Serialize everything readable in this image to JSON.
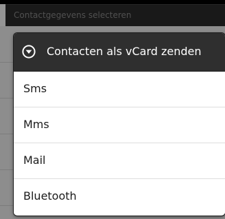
{
  "screen": {
    "title": "Contactgegevens selecteren"
  },
  "dialog": {
    "title": "Contacten als vCard zenden",
    "icon": "chevron-down-circle-icon",
    "items": [
      {
        "label": "Sms"
      },
      {
        "label": "Mms"
      },
      {
        "label": "Mail"
      },
      {
        "label": "Bluetooth"
      }
    ]
  },
  "colors": {
    "header_bg": "#2f2f2f",
    "title_bar_bg": "#2b2b2b",
    "dim_overlay": "rgba(0,0,0,0.42)",
    "item_text": "#1a1a1a",
    "divider": "#dddddd"
  }
}
